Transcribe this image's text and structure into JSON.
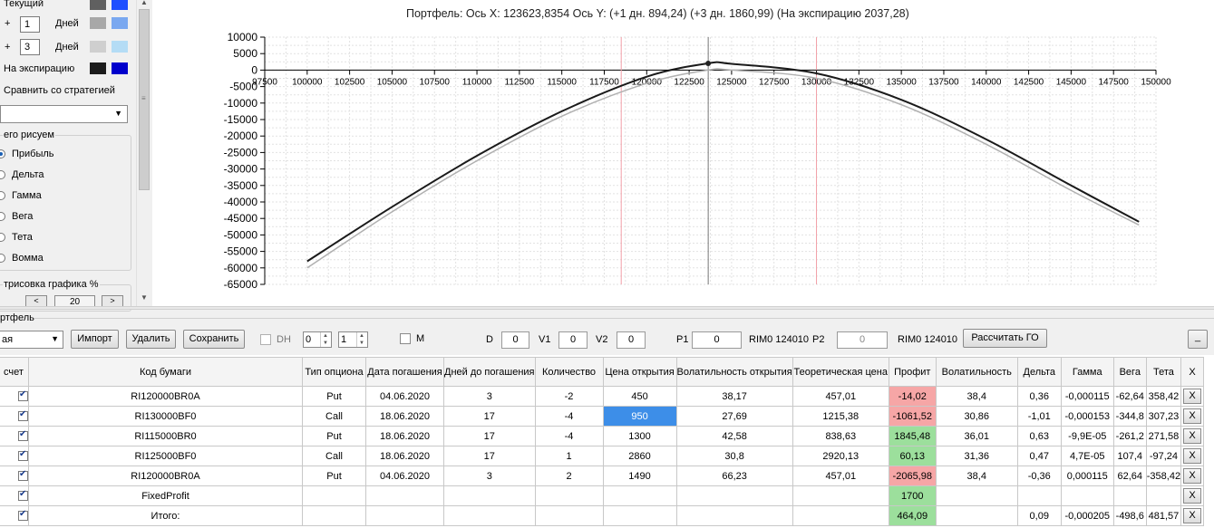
{
  "left_panel": {
    "lines": [
      {
        "label": "Текущий",
        "sign": "",
        "days": "",
        "days_label": "",
        "color1": "#606060",
        "color2": "#1e4fff"
      },
      {
        "label": "",
        "sign": "+",
        "days": "1",
        "days_label": "Дней",
        "color1": "#a8a8a8",
        "color2": "#7aa8f0"
      },
      {
        "label": "",
        "sign": "+",
        "days": "3",
        "days_label": "Дней",
        "color1": "#cfcfcf",
        "color2": "#b4dcf5"
      },
      {
        "label": "На экспирацию",
        "sign": "",
        "days": "",
        "days_label": "",
        "color1": "#1c1c1c",
        "color2": "#0000cc"
      }
    ],
    "compare_label": "Сравнить со стратегией",
    "draw_group_label": "его рисуем",
    "radio_options": [
      "Прибыль",
      "Дельта",
      "Гамма",
      "Вега",
      "Тета",
      "Вомма"
    ],
    "radio_selected": 0,
    "render_label": "трисовка графика %",
    "render_value": "20"
  },
  "chart": {
    "header": "Портфель:  Ось X: 123623,8354  Ось Y:  (+1 дн. 894,24)  (+3 дн. 1860,99)  (На экспирацию 2037,28)"
  },
  "chart_data": {
    "type": "line",
    "xlim": [
      97500,
      150000
    ],
    "ylim": [
      -65000,
      10000
    ],
    "x_ticks": [
      "97500",
      "100000",
      "102500",
      "105000",
      "107500",
      "110000",
      "112500",
      "115000",
      "117500",
      "120000",
      "122500",
      "125000",
      "127500",
      "130000",
      "132500",
      "135000",
      "137500",
      "140000",
      "142500",
      "145000",
      "147500",
      "150000"
    ],
    "y_ticks": [
      "10000",
      "5000",
      "0",
      "-5000",
      "-10000",
      "-15000",
      "-20000",
      "-25000",
      "-30000",
      "-35000",
      "-40000",
      "-45000",
      "-50000",
      "-55000",
      "-60000",
      "-65000"
    ],
    "x_tick_values": [
      97500,
      100000,
      102500,
      105000,
      107500,
      110000,
      112500,
      115000,
      117500,
      120000,
      122500,
      125000,
      127500,
      130000,
      132500,
      135000,
      137500,
      140000,
      142500,
      145000,
      147500,
      150000
    ],
    "y_tick_values": [
      10000,
      5000,
      0,
      -5000,
      -10000,
      -15000,
      -20000,
      -25000,
      -30000,
      -35000,
      -40000,
      -45000,
      -50000,
      -55000,
      -60000,
      -65000
    ],
    "cursor_x": 123623.8354,
    "cursor_y": 2037.28,
    "strike_lines": [
      118500,
      130000
    ],
    "series": [
      {
        "color": "#b0b0b0",
        "x": [
          100000,
          105000,
          110000,
          115000,
          120000,
          123600,
          125000,
          130000,
          135000,
          140000,
          145000,
          149000
        ],
        "y": [
          -60000,
          -43000,
          -27500,
          -14000,
          -4000,
          0,
          0,
          -2500,
          -10500,
          -22500,
          -36500,
          -47000
        ]
      },
      {
        "color": "#1a1a1a",
        "x": [
          100000,
          105000,
          110000,
          115000,
          120000,
          123600,
          125000,
          130000,
          135000,
          140000,
          145000,
          149000
        ],
        "y": [
          -58000,
          -41500,
          -26000,
          -12500,
          -2000,
          2037,
          1900,
          -1000,
          -9000,
          -21000,
          -35000,
          -46000
        ]
      }
    ]
  },
  "portfolio_panel": {
    "title": "ртфель",
    "dropdown_value": "ая",
    "import_label": "Импорт",
    "delete_label": "Удалить",
    "save_label": "Сохранить",
    "dh_label": "DH",
    "spin1": "0",
    "spin2": "1",
    "m_label": "M",
    "d_label": "D",
    "d_value": "0",
    "v1_label": "V1",
    "v1_value": "0",
    "v2_label": "V2",
    "v2_value": "0",
    "p1_label": "P1",
    "p1_value": "0",
    "ticker1": "RIM0 124010",
    "p2_label": "P2",
    "p2_value": "0",
    "ticker2": "RIM0 124010",
    "calc_go_label": "Рассчитать ГО",
    "minimize_label": "_"
  },
  "table": {
    "headers": [
      "счет",
      "Код бумаги",
      "Тип опциона",
      "Дата погашения",
      "Дней до погашения",
      "Количество",
      "Цена открытия",
      "Волатильность открытия",
      "Теоретическая цена",
      "Профит",
      "Волатильность",
      "Дельта",
      "Гамма",
      "Вега",
      "Тета",
      "X"
    ],
    "rows": [
      {
        "code": "RI120000BR0A",
        "type": "Put",
        "date": "04.06.2020",
        "days": "3",
        "qty": "-2",
        "price": "450",
        "vol_open": "38,17",
        "theo": "457,01",
        "profit": "-14,02",
        "profit_color": "red",
        "vol": "38,4",
        "delta": "0,36",
        "gamma": "-0,000115",
        "vega": "-62,64",
        "theta": "358,42",
        "x": "X",
        "price_sel": false
      },
      {
        "code": "RI130000BF0",
        "type": "Call",
        "date": "18.06.2020",
        "days": "17",
        "qty": "-4",
        "price": "950",
        "vol_open": "27,69",
        "theo": "1215,38",
        "profit": "-1061,52",
        "profit_color": "red",
        "vol": "30,86",
        "delta": "-1,01",
        "gamma": "-0,000153",
        "vega": "-344,8",
        "theta": "307,23",
        "x": "X",
        "price_sel": true
      },
      {
        "code": "RI115000BR0",
        "type": "Put",
        "date": "18.06.2020",
        "days": "17",
        "qty": "-4",
        "price": "1300",
        "vol_open": "42,58",
        "theo": "838,63",
        "profit": "1845,48",
        "profit_color": "green",
        "vol": "36,01",
        "delta": "0,63",
        "gamma": "-9,9E-05",
        "vega": "-261,2",
        "theta": "271,58",
        "x": "X",
        "price_sel": false
      },
      {
        "code": "RI125000BF0",
        "type": "Call",
        "date": "18.06.2020",
        "days": "17",
        "qty": "1",
        "price": "2860",
        "vol_open": "30,8",
        "theo": "2920,13",
        "profit": "60,13",
        "profit_color": "green",
        "vol": "31,36",
        "delta": "0,47",
        "gamma": "4,7E-05",
        "vega": "107,4",
        "theta": "-97,24",
        "x": "X",
        "price_sel": false
      },
      {
        "code": "RI120000BR0A",
        "type": "Put",
        "date": "04.06.2020",
        "days": "3",
        "qty": "2",
        "price": "1490",
        "vol_open": "66,23",
        "theo": "457,01",
        "profit": "-2065,98",
        "profit_color": "red",
        "vol": "38,4",
        "delta": "-0,36",
        "gamma": "0,000115",
        "vega": "62,64",
        "theta": "-358,42",
        "x": "X",
        "price_sel": false
      },
      {
        "code": "FixedProfit",
        "type": "",
        "date": "",
        "days": "",
        "qty": "",
        "price": "",
        "vol_open": "",
        "theo": "",
        "profit": "1700",
        "profit_color": "green",
        "vol": "",
        "delta": "",
        "gamma": "",
        "vega": "",
        "theta": "",
        "x": "X",
        "price_sel": false
      },
      {
        "code": "Итого:",
        "type": "",
        "date": "",
        "days": "",
        "qty": "",
        "price": "",
        "vol_open": "",
        "theo": "",
        "profit": "464,09",
        "profit_color": "green",
        "vol": "",
        "delta": "0,09",
        "gamma": "-0,000205",
        "vega": "-498,6",
        "theta": "481,57",
        "x": "X",
        "price_sel": false
      }
    ]
  }
}
